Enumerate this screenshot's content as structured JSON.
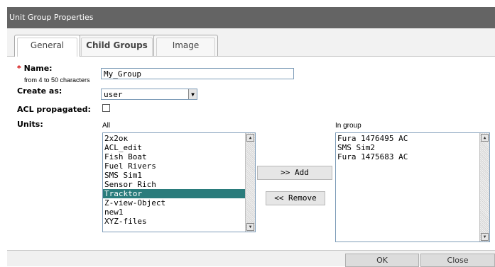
{
  "window": {
    "title": "Unit Group Properties"
  },
  "tabs": [
    {
      "label": "General",
      "active": true
    },
    {
      "label": "Child Groups",
      "active": false
    },
    {
      "label": "Image",
      "active": false
    }
  ],
  "form": {
    "name": {
      "required_mark": "*",
      "label": "Name:",
      "hint": "from 4 to 50 characters",
      "value": "My_Group"
    },
    "create_as": {
      "label": "Create as:",
      "value": "user"
    },
    "acl": {
      "label": "ACL propagated:",
      "checked": false
    },
    "units": {
      "label": "Units:",
      "all_label": "All",
      "in_group_label": "In group",
      "all_items": [
        "2x2ок",
        "ACL_edit",
        "Fish Boat",
        "Fuel Rivers",
        "SMS Sim1",
        "Sensor Rich",
        "Tracktor",
        "Z-view-Object",
        "new1",
        "XYZ-files"
      ],
      "selected_item": "Tracktor",
      "in_group_items": [
        "Fura 1476495 AC",
        "SMS Sim2",
        "Fura 1475683 AC"
      ]
    },
    "add_label": ">> Add",
    "remove_label": "<< Remove"
  },
  "footer": {
    "ok_label": "OK",
    "close_label": "Close"
  },
  "icons": {
    "dropdown": "chevron-down-icon",
    "scroll_up": "arrow-up-icon",
    "scroll_down": "arrow-down-icon"
  }
}
